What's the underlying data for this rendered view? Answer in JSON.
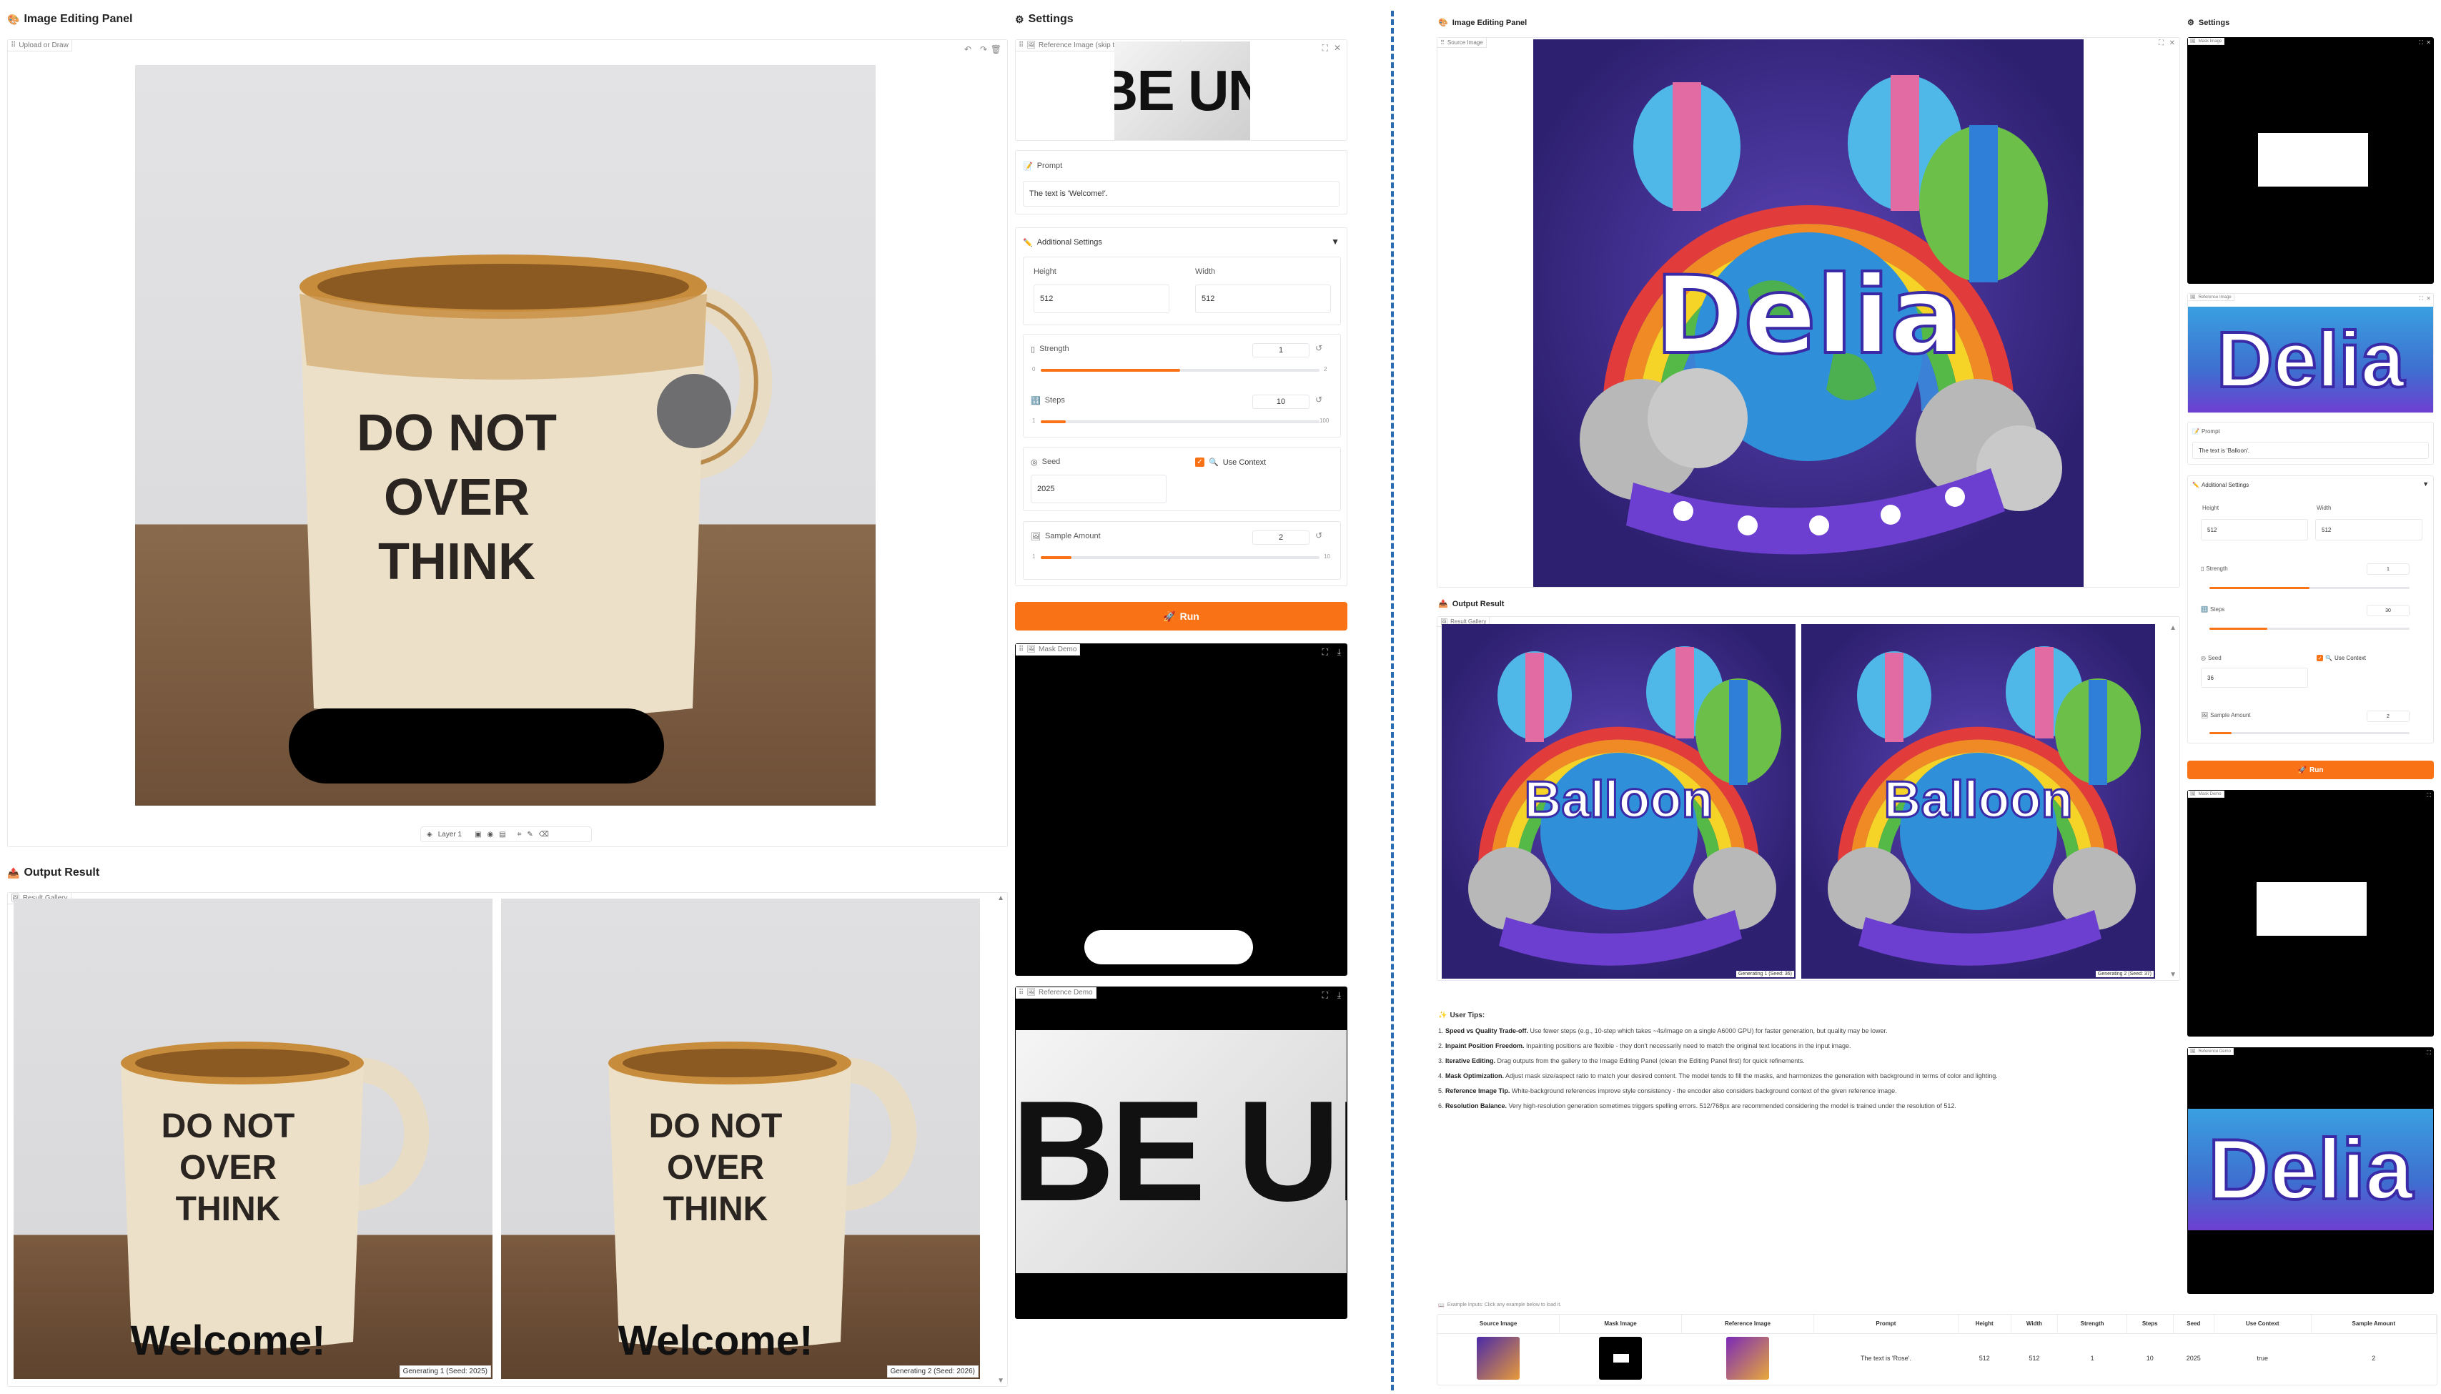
{
  "left": {
    "editing_panel": {
      "title": "Image Editing Panel",
      "tab": "Upload or Draw",
      "layer": "Layer 1"
    },
    "settings": {
      "title": "Settings",
      "reference_label": "Reference Image (skip this if self-reference)",
      "reference_text": "BE UN",
      "prompt_label": "Prompt",
      "prompt_value": "The text is 'Welcome!'.",
      "additional_label": "Additional Settings",
      "height_label": "Height",
      "height_value": "512",
      "width_label": "Width",
      "width_value": "512",
      "strength_label": "Strength",
      "strength_value": "1",
      "strength_min": "0",
      "strength_max": "2",
      "strength_fraction": 0.5,
      "steps_label": "Steps",
      "steps_value": "10",
      "steps_min": "1",
      "steps_max": "100",
      "steps_fraction": 0.09,
      "seed_label": "Seed",
      "seed_value": "2025",
      "use_context_label": "Use Context",
      "sample_label": "Sample Amount",
      "sample_value": "2",
      "sample_min": "1",
      "sample_max": "10",
      "sample_fraction": 0.11,
      "run_label": "Run",
      "mask_demo_label": "Mask Demo",
      "reference_demo_label": "Reference Demo"
    },
    "mug": {
      "line1": "DO NOT",
      "line2": "OVER",
      "line3": "THINK",
      "welcome": "Welcome!"
    },
    "output": {
      "title": "Output Result",
      "gallery_label": "Result Gallery",
      "caption1": "Generating 1 (Seed: 2025)",
      "caption2": "Generating 2 (Seed: 2026)"
    }
  },
  "right": {
    "editing_panel": {
      "title": "Image Editing Panel",
      "tab": "Source Image"
    },
    "source_word": "Delia",
    "settings": {
      "title": "Settings",
      "mask_label": "Mask Image",
      "reference_label": "Reference Image",
      "prompt_label": "Prompt",
      "prompt_value": "The text is 'Balloon'.",
      "additional_label": "Additional Settings",
      "height_label": "Height",
      "height_value": "512",
      "width_label": "Width",
      "width_value": "512",
      "strength_label": "Strength",
      "strength_value": "1",
      "steps_label": "Steps",
      "steps_value": "30",
      "seed_label": "Seed",
      "seed_value": "36",
      "use_context_label": "Use Context",
      "sample_label": "Sample Amount",
      "sample_value": "2",
      "run_label": "Run",
      "mask_demo_label": "Mask Demo",
      "reference_demo_label": "Reference Demo"
    },
    "output": {
      "title": "Output Result",
      "gallery_label": "Result Gallery",
      "word": "Balloon",
      "caption1": "Generating 1 (Seed: 36)",
      "caption2": "Generating 2 (Seed: 37)"
    },
    "tips": {
      "title": "User Tips:",
      "items": [
        {
          "n": "1.",
          "b": "Speed vs Quality Trade-off.",
          "t": " Use fewer steps (e.g., 10-step which takes ~4s/image on a single A6000 GPU) for faster generation, but quality may be lower."
        },
        {
          "n": "2.",
          "b": "Inpaint Position Freedom.",
          "t": " Inpainting positions are flexible - they don't necessarily need to match the original text locations in the input image."
        },
        {
          "n": "3.",
          "b": "Iterative Editing.",
          "t": " Drag outputs from the gallery to the Image Editing Panel (clean the Editing Panel first) for quick refinements."
        },
        {
          "n": "4.",
          "b": "Mask Optimization.",
          "t": " Adjust mask size/aspect ratio to match your desired content. The model tends to fill the masks, and harmonizes the generation with background in terms of color and lighting."
        },
        {
          "n": "5.",
          "b": "Reference Image Tip.",
          "t": " White-background references improve style consistency - the encoder also considers background context of the given reference image."
        },
        {
          "n": "6.",
          "b": "Resolution Balance.",
          "t": " Very high-resolution generation sometimes triggers spelling errors. 512/768px are recommended considering the model is trained under the resolution of 512."
        }
      ]
    },
    "examples": {
      "label": "Example Inputs: Click any example below to load it.",
      "headers": [
        "Source Image",
        "Mask Image",
        "Reference Image",
        "Prompt",
        "Height",
        "Width",
        "Strength",
        "Steps",
        "Seed",
        "Use Context",
        "Sample Amount"
      ],
      "row": [
        "The text is 'Rose'.",
        "512",
        "512",
        "1",
        "10",
        "2025",
        "true",
        "2"
      ]
    }
  },
  "colors": {
    "accent": "#f97316",
    "divider": "#2b6cb0"
  }
}
